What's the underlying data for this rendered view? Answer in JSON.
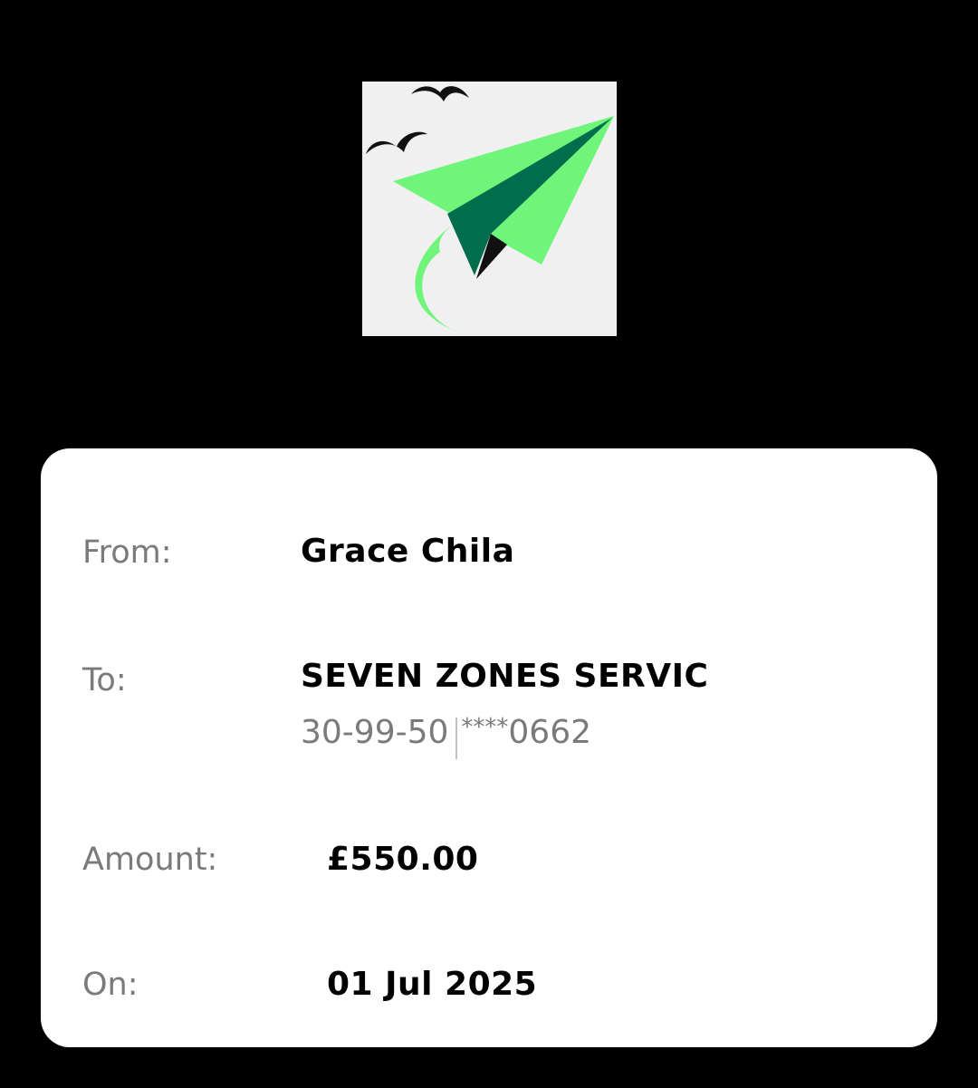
{
  "logo": {
    "name": "paper-plane-logo"
  },
  "receipt": {
    "from_label": "From:",
    "from_value": "Grace Chila",
    "to_label": "To:",
    "to_value": "SEVEN ZONES SERVIC",
    "sort_code": "30-99-50",
    "account_mask": "****",
    "account_last4": "0662",
    "amount_label": "Amount:",
    "amount_value": "£550.00",
    "on_label": "On:",
    "on_value": "01 Jul 2025"
  },
  "colors": {
    "background": "#000000",
    "card": "#ffffff",
    "label": "#7a7a7a",
    "plane_light": "#6ef57a",
    "plane_dark": "#006e4d",
    "logo_bg": "#f0f0f0"
  }
}
